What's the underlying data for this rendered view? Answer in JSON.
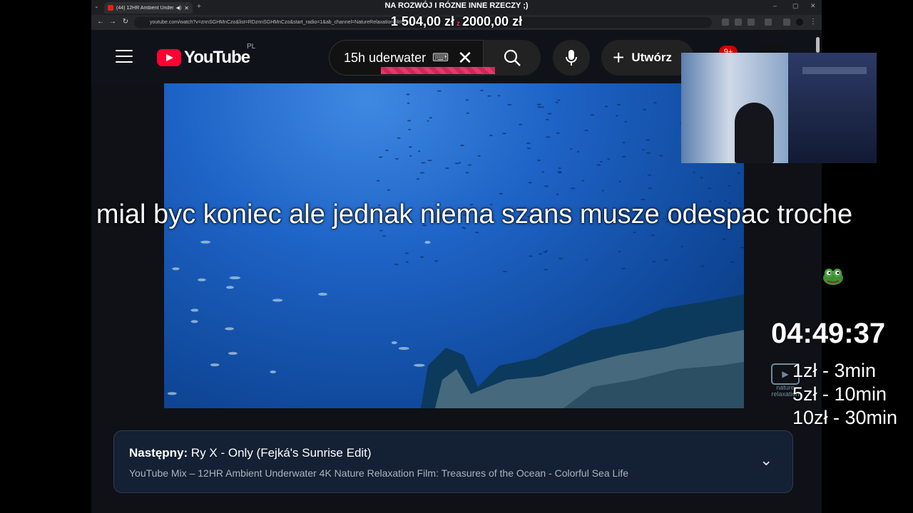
{
  "overlay": {
    "goal_text": "NA ROZWÓJ I RÓZNE INNE RZECZY ;)",
    "goal_current": "1 504,00 zł",
    "goal_separator": "z",
    "goal_target": "2000,00 zł",
    "subtitle": "mial byc koniec ale jednak niema szans musze odespac troche",
    "timer": "04:49:37",
    "rates": [
      "1zł - 3min",
      "5zł - 10min",
      "10zł - 30min"
    ],
    "nature_logo_text": "nature relaxation"
  },
  "browser": {
    "tab_title": "(44) 12HR Ambient Underw",
    "url": "youtube.com/watch?v=znnSGHMnCzo&list=RDznnSGHMnCzo&start_radio=1&ab_channel=NatureRelaxationFilms"
  },
  "youtube": {
    "logo_text": "YouTube",
    "region": "PL",
    "search_value": "15h uderwater",
    "create_label": "Utwórz",
    "notifications_count": "9+",
    "next_label": "Następny:",
    "next_title": "Ry X - Only (Fejká's Sunrise Edit)",
    "next_subtitle": "YouTube Mix – 12HR Ambient Underwater 4K Nature Relaxation Film: Treasures of the Ocean - Colorful Sea Life"
  },
  "colors": {
    "accent": "#ff0033",
    "donation_bar": "#e23a6a",
    "water": "#1e63c6"
  },
  "icons": [
    "menu-icon",
    "youtube-logo-icon",
    "keyboard-icon",
    "close-icon",
    "search-icon",
    "mic-icon",
    "plus-icon",
    "bell-icon",
    "chevron-down-icon",
    "pepe-emote-icon"
  ]
}
